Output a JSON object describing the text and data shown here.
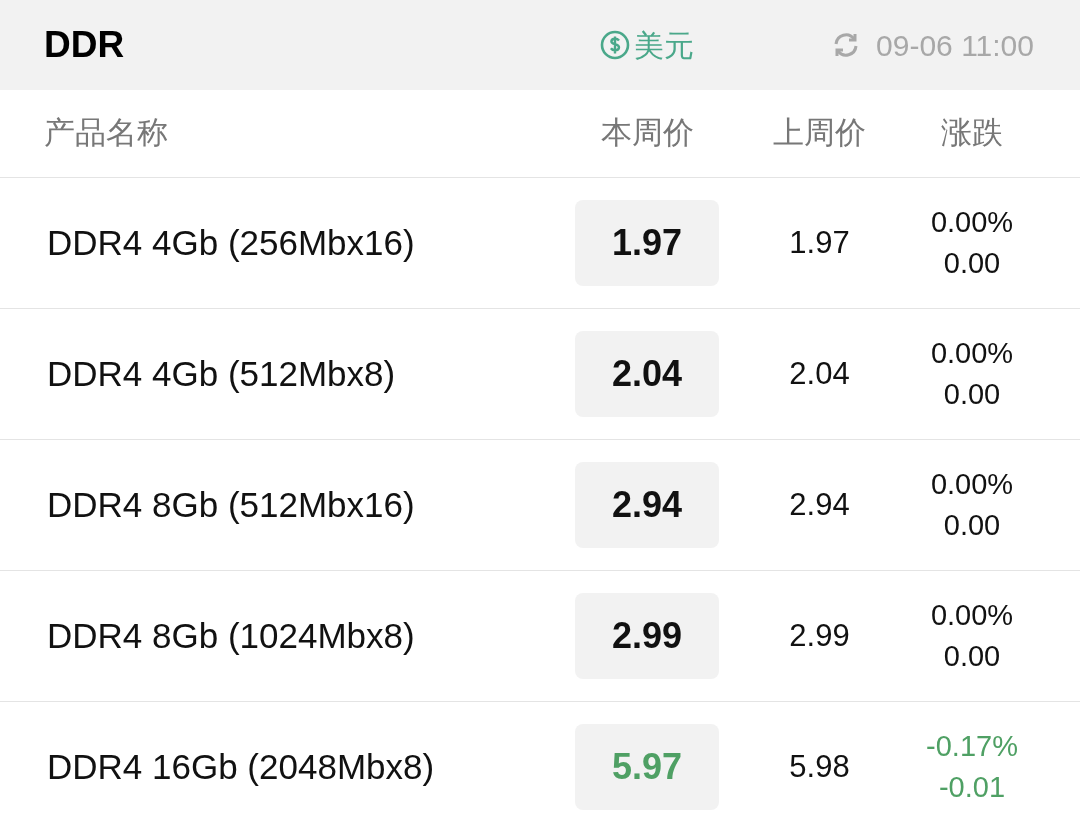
{
  "header": {
    "title": "DDR",
    "currency": "美元",
    "updated": "09-06 11:00"
  },
  "table": {
    "columns": [
      "产品名称",
      "本周价",
      "上周价",
      "涨跌"
    ],
    "rows": [
      {
        "name": "DDR4 4Gb (256Mbx16)",
        "this_week": "1.97",
        "last_week": "1.97",
        "change_pct": "0.00%",
        "change": "0.00",
        "kind": "flat"
      },
      {
        "name": "DDR4 4Gb (512Mbx8)",
        "this_week": "2.04",
        "last_week": "2.04",
        "change_pct": "0.00%",
        "change": "0.00",
        "kind": "flat"
      },
      {
        "name": "DDR4 8Gb (512Mbx16)",
        "this_week": "2.94",
        "last_week": "2.94",
        "change_pct": "0.00%",
        "change": "0.00",
        "kind": "flat"
      },
      {
        "name": "DDR4 8Gb (1024Mbx8)",
        "this_week": "2.99",
        "last_week": "2.99",
        "change_pct": "0.00%",
        "change": "0.00",
        "kind": "flat"
      },
      {
        "name": "DDR4 16Gb (2048Mbx8)",
        "this_week": "5.97",
        "last_week": "5.98",
        "change_pct": "-0.17%",
        "change": "-0.01",
        "kind": "down"
      }
    ]
  }
}
